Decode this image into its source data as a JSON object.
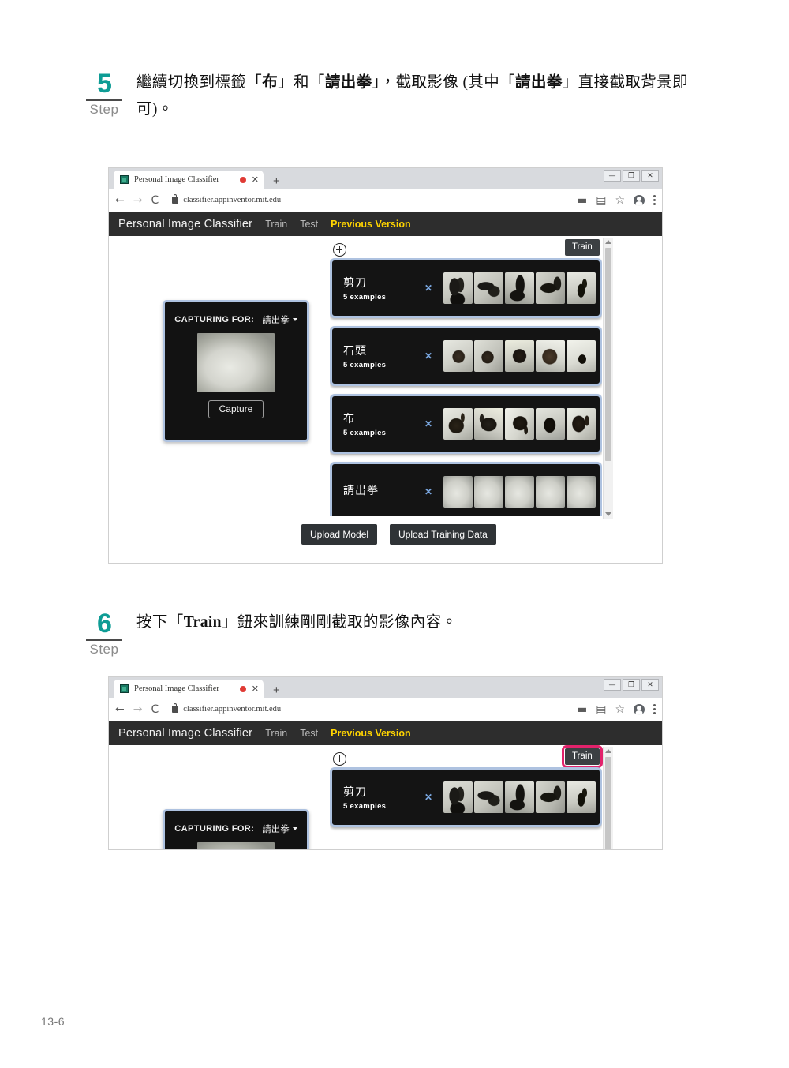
{
  "page": {
    "folio": "13-6"
  },
  "steps": [
    {
      "number": "5",
      "word": "Step",
      "text_html": "繼續切換到標籤「<b>布</b>」和「<b>請出拳</b>」，截取影像 (其中「<b>請出拳</b>」直接截取背景即可)。"
    },
    {
      "number": "6",
      "word": "Step",
      "text_html": "按下「<b>Train</b>」鈕來訓練剛剛截取的影像內容。"
    }
  ],
  "browser": {
    "tab_title": "Personal Image Classifier",
    "tab_close": "✕",
    "new_tab": "+",
    "window_buttons": {
      "minimize": "—",
      "restore": "❐",
      "close": "✕"
    },
    "back": "←",
    "forward": "→",
    "reload": "C",
    "url": "classifier.appinventor.mit.edu",
    "omni_icons": [
      "cast-icon",
      "extension-icon",
      "bookmark-star-icon",
      "profile-avatar-icon",
      "kebab-menu-icon"
    ]
  },
  "app": {
    "brand": "Personal Image Classifier",
    "nav": [
      {
        "label": "Train",
        "accent": false
      },
      {
        "label": "Test",
        "accent": false
      },
      {
        "label": "Previous Version",
        "accent": true
      }
    ],
    "accent_color": "#ffd400",
    "navbar_color": "#2d2d2d",
    "capture": {
      "label": "CAPTURING FOR:",
      "selected": "請出拳",
      "button": "Capture"
    },
    "train_button": "Train",
    "add_label_icon": "circle-plus-icon",
    "cards": [
      {
        "name": "剪刀",
        "count": "5 examples",
        "remove": "✕",
        "thumbs": [
          "t-sc1",
          "t-sc2",
          "t-sc3",
          "t-sc4",
          "t-sc5"
        ]
      },
      {
        "name": "石頭",
        "count": "5 examples",
        "remove": "✕",
        "thumbs": [
          "t-rk1",
          "t-rk2",
          "t-rk3",
          "t-rk4",
          "t-rk5"
        ]
      },
      {
        "name": "布",
        "count": "5 examples",
        "remove": "✕",
        "thumbs": [
          "t-pp1",
          "t-pp2",
          "t-pp3",
          "t-pp4",
          "t-pp5"
        ]
      },
      {
        "name": "請出拳",
        "count": "",
        "remove": "✕",
        "thumbs": [
          "t-bg",
          "t-bg",
          "t-bg",
          "t-bg",
          "t-bg"
        ]
      }
    ],
    "bottom_actions": [
      {
        "label": "Upload Model"
      },
      {
        "label": "Upload Training Data"
      }
    ]
  },
  "figure2": {
    "highlight_color": "#e2226b",
    "cards": [
      {
        "name": "剪刀",
        "count": "5 examples",
        "remove": "✕",
        "thumbs": [
          "t-sc1",
          "t-sc2",
          "t-sc3",
          "t-sc4",
          "t-sc5"
        ]
      }
    ]
  }
}
